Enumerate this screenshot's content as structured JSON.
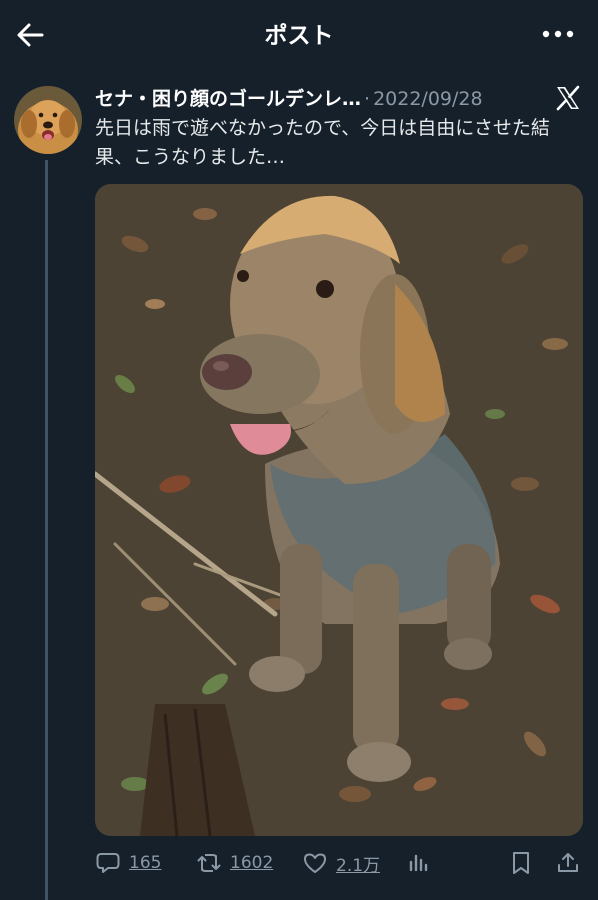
{
  "header": {
    "title": "ポスト",
    "back_icon": "arrow-left-icon",
    "more_icon": "more-horizontal-icon"
  },
  "post": {
    "author_name": "セナ・困り顔のゴールデンレ…",
    "separator": "·",
    "date": "2022/09/28",
    "text": "先日は雨で遊べなかったので、今日は自由にさせた結果、こうなりました…",
    "media_alt": "mud-covered golden retriever sitting on leaf-covered forest ground",
    "brand_icon": "x-logo-icon"
  },
  "actions": {
    "replies": "165",
    "reposts": "1602",
    "likes": "2.1万"
  },
  "colors": {
    "background": "#15202b",
    "text": "#e7e9ea",
    "muted": "#8b98a5"
  }
}
